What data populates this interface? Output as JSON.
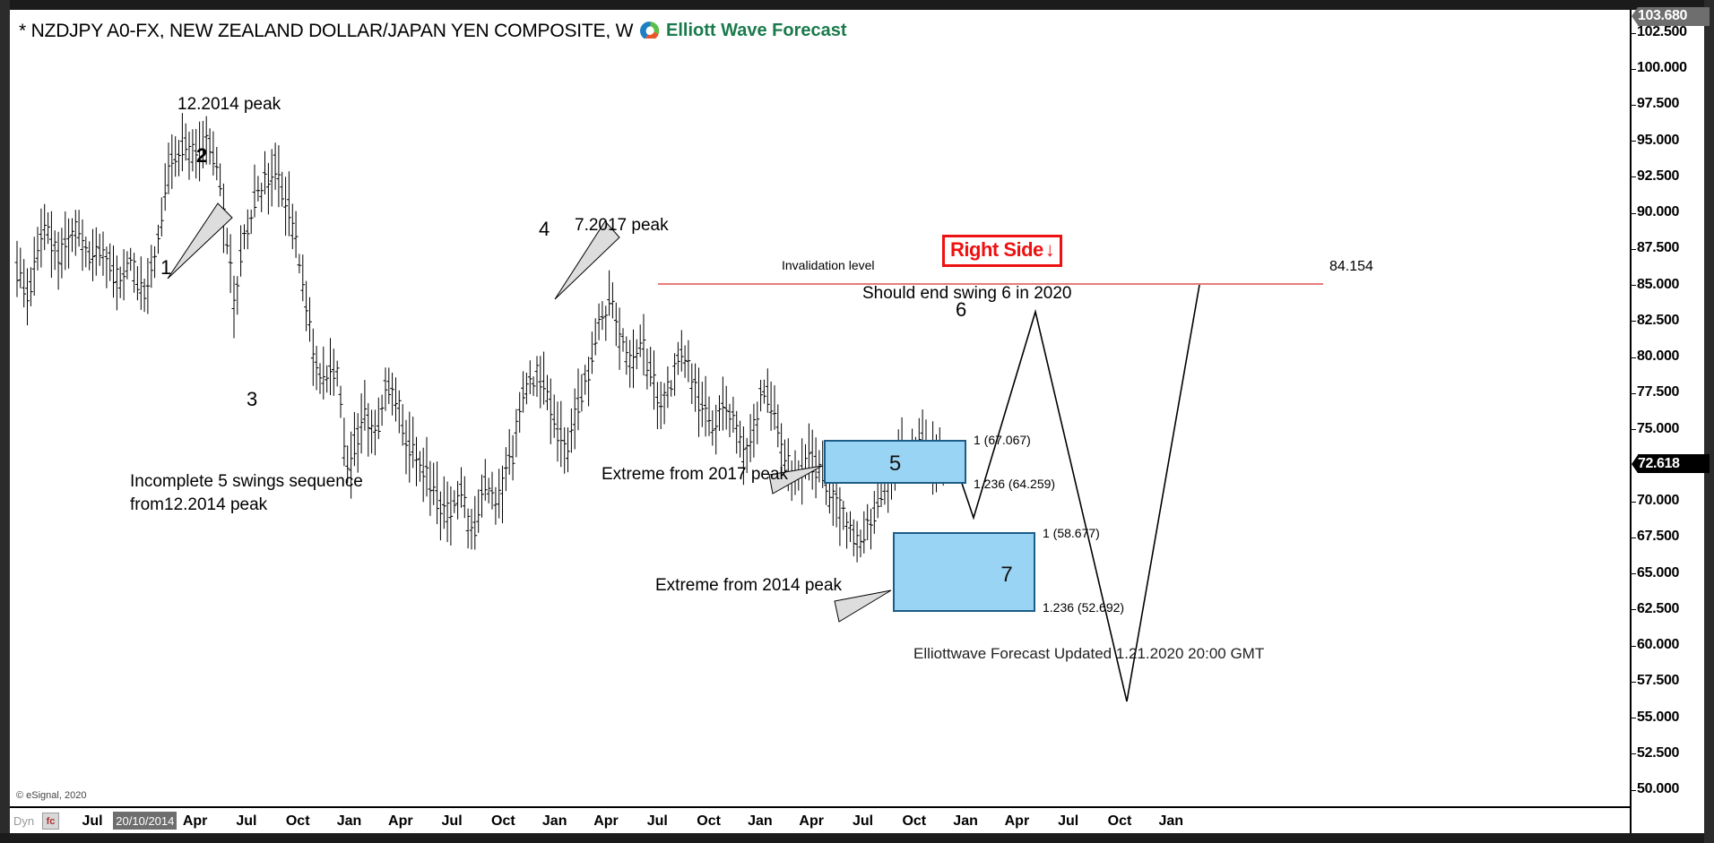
{
  "window": {
    "title": "* NZDJPY A0-FX, NEW ZEALAND DOLLAR/JAPAN YEN COMPOSITE, W",
    "brand": "Elliott Wave Forecast",
    "restore_button": "restore-window"
  },
  "chart_data": {
    "type": "line",
    "subtype": "ohlc-bar",
    "title": "* NZDJPY A0-FX, NEW ZEALAND DOLLAR/JAPAN YEN COMPOSITE, W",
    "symbol": "NZDJPY A0-FX",
    "instrument": "NEW ZEALAND DOLLAR/JAPAN YEN COMPOSITE",
    "timeframe": "W",
    "xlabel": "",
    "ylabel": "",
    "ylim": [
      49.0,
      103.68
    ],
    "grid": false,
    "legend": "none",
    "y_ticks": [
      "102.500",
      "100.000",
      "97.500",
      "95.000",
      "92.500",
      "90.000",
      "87.500",
      "85.000",
      "82.500",
      "80.000",
      "77.500",
      "75.000",
      "70.000",
      "67.500",
      "65.000",
      "62.500",
      "60.000",
      "57.500",
      "55.000",
      "52.500",
      "50.000"
    ],
    "y_tick_values": [
      102.5,
      100.0,
      97.5,
      95.0,
      92.5,
      90.0,
      87.5,
      85.0,
      82.5,
      80.0,
      77.5,
      75.0,
      70.0,
      67.5,
      65.0,
      62.5,
      60.0,
      57.5,
      55.0,
      52.5,
      50.0
    ],
    "x_ticks": [
      "Jul",
      "Jan",
      "Apr",
      "Jul",
      "Oct",
      "Jan",
      "Apr",
      "Jul",
      "Oct",
      "Jan",
      "Apr",
      "Jul",
      "Oct",
      "Jan",
      "Apr",
      "Jul",
      "Oct",
      "Jan",
      "Apr",
      "Jul",
      "Oct",
      "Jan"
    ],
    "price_markers": [
      {
        "name": "high-marker",
        "value": "103.680",
        "color": "#6e6e6e"
      },
      {
        "name": "last-price-marker",
        "value": "72.618",
        "color": "#000000"
      }
    ],
    "date_cursor": "20/10/2014",
    "invalidation": {
      "label": "Invalidation level",
      "price": "84.154",
      "color": "#e05050"
    },
    "zones": [
      {
        "name": "swing-5-zone",
        "label": "5",
        "upper_label": "1 (67.067)",
        "lower_label": "1.236 (64.259)",
        "upper_value": 67.067,
        "lower_value": 64.259,
        "callout": "Extreme from 2017 peak",
        "fill": "#9ad4f5"
      },
      {
        "name": "swing-7-zone",
        "label": "7",
        "upper_label": "1 (58.677)",
        "lower_label": "1.236 (52.692)",
        "upper_value": 58.677,
        "lower_value": 52.692,
        "callout": "Extreme from 2014 peak",
        "fill": "#9ad4f5"
      }
    ],
    "wave_labels": [
      "1",
      "2",
      "3",
      "4",
      "5",
      "6",
      "7"
    ],
    "annotations": [
      {
        "name": "peak-2014-callout",
        "text": "12.2014 peak"
      },
      {
        "name": "peak-2017-callout",
        "text": "7.2017 peak"
      },
      {
        "name": "incomplete-sequence-note",
        "line1": "Incomplete 5 swings sequence",
        "line2": "from12.2014 peak"
      },
      {
        "name": "swing-6-note",
        "text": "Should end swing 6 in 2020"
      },
      {
        "name": "right-side-badge",
        "text": "Right Side",
        "arrow": "↓",
        "color": "#ee1111"
      }
    ],
    "footer": "Elliottwave Forecast Updated 1.21.2020 20:00 GMT",
    "copyright": "© eSignal, 2020",
    "toolbar": {
      "dyn_label": "Dyn",
      "fn_icon": "fc"
    }
  }
}
